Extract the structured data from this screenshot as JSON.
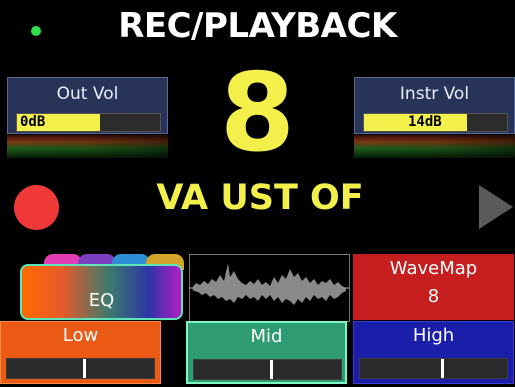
{
  "header": {
    "title": "REC/PLAYBACK",
    "status_color": "#2ee04a"
  },
  "out_vol": {
    "label": "Out Vol",
    "value": "0dB",
    "level": 0.58
  },
  "instr_vol": {
    "label": "Instr Vol",
    "value": "14dB",
    "level": 0.72
  },
  "track": {
    "number": "8",
    "name": "VA UST OF"
  },
  "controls": {
    "record_icon": "record-icon",
    "play_icon": "play-icon"
  },
  "eq": {
    "label": "EQ",
    "tab_colors": [
      "#e33cb5",
      "#7d3fc2",
      "#2d8fd6",
      "#d4a32a"
    ]
  },
  "wavemap": {
    "label": "WaveMap",
    "value": "8"
  },
  "bands": [
    {
      "label": "Low",
      "position": 0.52
    },
    {
      "label": "Mid",
      "position": 0.52
    },
    {
      "label": "High",
      "position": 0.55
    }
  ],
  "colors": {
    "accent": "#f3f04b",
    "panel_blue": "#283457",
    "wavemap_red": "#c61e1e"
  }
}
